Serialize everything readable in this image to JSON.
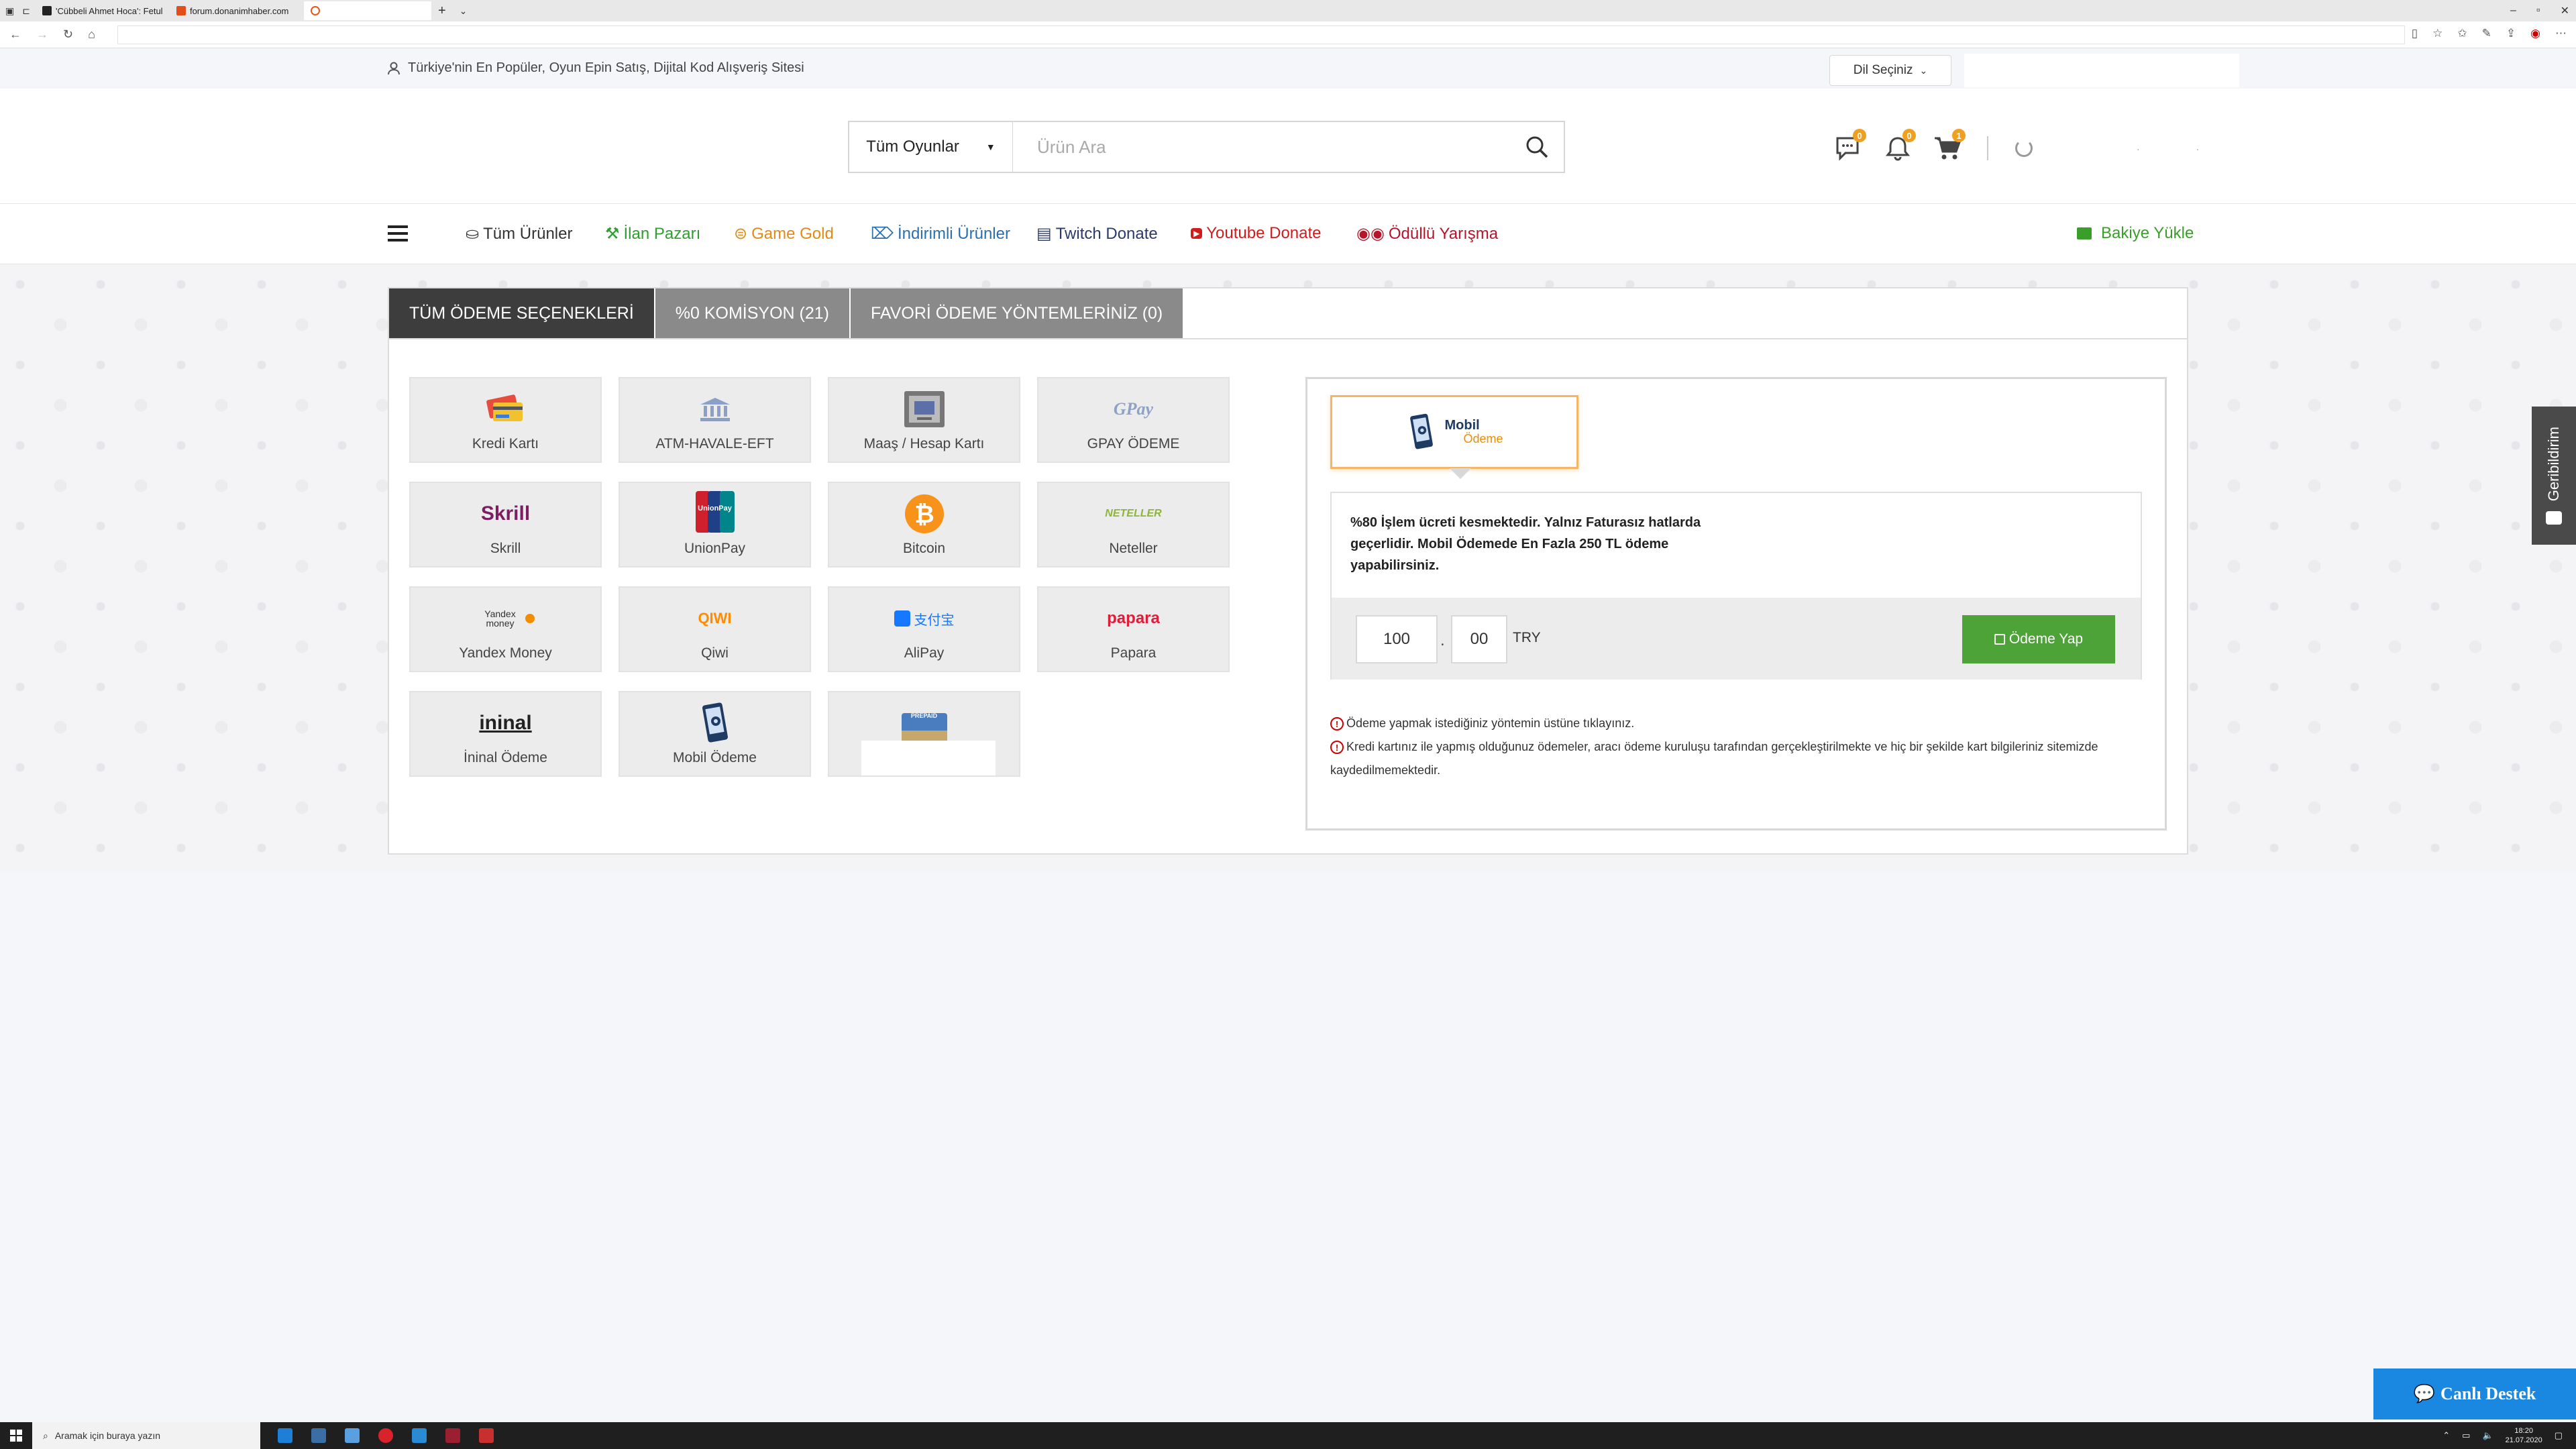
{
  "browser": {
    "tabs": [
      {
        "label": "'Cübbeli Ahmet Hoca': Fetul",
        "favicon_color": "#222222"
      },
      {
        "label": "forum.donanimhaber.com",
        "favicon_color": "#e34d1a"
      },
      {
        "label": "",
        "favicon_color": "#e8581c"
      }
    ]
  },
  "topbar": {
    "tagline": "Türkiye'nin En Popüler, Oyun Epin Satış, Dijital Kod Alışveriş Sitesi",
    "language_label": "Dil Seçiniz"
  },
  "header": {
    "category_label": "Tüm Oyunlar",
    "search_placeholder": "Ürün Ara",
    "messages_count": "0",
    "notifications_count": "0",
    "cart_count": "1"
  },
  "nav": {
    "items": [
      {
        "label": "Tüm Ürünler",
        "color": "#333333"
      },
      {
        "label": "İlan Pazarı",
        "color": "#2e9e2e"
      },
      {
        "label": "Game Gold",
        "color": "#e08a18"
      },
      {
        "label": "İndirimli Ürünler",
        "color": "#2a6fb0"
      },
      {
        "label": "Twitch Donate",
        "color": "#2a3b6b"
      },
      {
        "label": "Youtube Donate",
        "color": "#d41b1b"
      },
      {
        "label": "Ödüllü Yarışma",
        "color": "#b8152a"
      }
    ],
    "balance_label": "Bakiye Yükle",
    "balance_color": "#3a9e2a"
  },
  "payment": {
    "tabs": [
      "TÜM ÖDEME SEÇENEKLERİ",
      "%0 KOMİSYON (21)",
      "FAVORİ ÖDEME YÖNTEMLERİNİZ (0)"
    ],
    "methods": [
      {
        "label": "Kredi Kartı",
        "icon": "credit-card-icon"
      },
      {
        "label": "ATM-HAVALE-EFT",
        "icon": "bank-icon"
      },
      {
        "label": "Maaş / Hesap Kartı",
        "icon": "salary-card-icon"
      },
      {
        "label": "GPAY ÖDEME",
        "icon": "gpay-logo"
      },
      {
        "label": "Skrill",
        "icon": "skrill-logo"
      },
      {
        "label": "UnionPay",
        "icon": "unionpay-logo"
      },
      {
        "label": "Bitcoin",
        "icon": "bitcoin-logo"
      },
      {
        "label": "Neteller",
        "icon": "neteller-logo"
      },
      {
        "label": "Yandex Money",
        "icon": "yandex-money-logo"
      },
      {
        "label": "Qiwi",
        "icon": "qiwi-logo"
      },
      {
        "label": "AliPay",
        "icon": "alipay-logo"
      },
      {
        "label": "Papara",
        "icon": "papara-logo"
      },
      {
        "label": "İninal Ödeme",
        "icon": "ininal-logo"
      },
      {
        "label": "Mobil Ödeme",
        "icon": "mobile-payment-icon"
      },
      {
        "label": "",
        "icon": "prepaid-card-icon"
      }
    ],
    "logo_texts": {
      "skrill": "Skrill",
      "unionpay": "UnionPay",
      "neteller": "NETELLER",
      "yandex": "Yandex money",
      "qiwi": "QIWI",
      "alipay": "支付宝",
      "papara": "papara",
      "ininal": "ininal",
      "gpay": "GPay",
      "prepaid": "PREPAID"
    },
    "selected": {
      "name": "Mobil Ödeme",
      "logo_word1": "Mobil",
      "logo_word2": "Ödeme",
      "info": "%80 İşlem ücreti kesmektedir. Yalnız Faturasız hatlarda geçerlidir. Mobil Ödemede En Fazla 250 TL ödeme yapabilirsiniz.",
      "amount_whole": "100",
      "amount_decimal": "00",
      "currency": "TRY",
      "pay_button": "Ödeme Yap"
    },
    "notes": [
      "Ödeme yapmak istediğiniz yöntemin üstüne tıklayınız.",
      "Kredi kartınız ile yapmış olduğunuz ödemeler, aracı ödeme kuruluşu tarafından gerçekleştirilmekte ve hiç bir şekilde kart bilgileriniz sitemizde kaydedilmemektedir."
    ]
  },
  "widgets": {
    "feedback_label": "Geribildirim",
    "live_support_label": "Canlı Destek"
  },
  "taskbar": {
    "search_placeholder": "Aramak için buraya yazın",
    "time": "18:20",
    "date": "21.07.2020"
  }
}
